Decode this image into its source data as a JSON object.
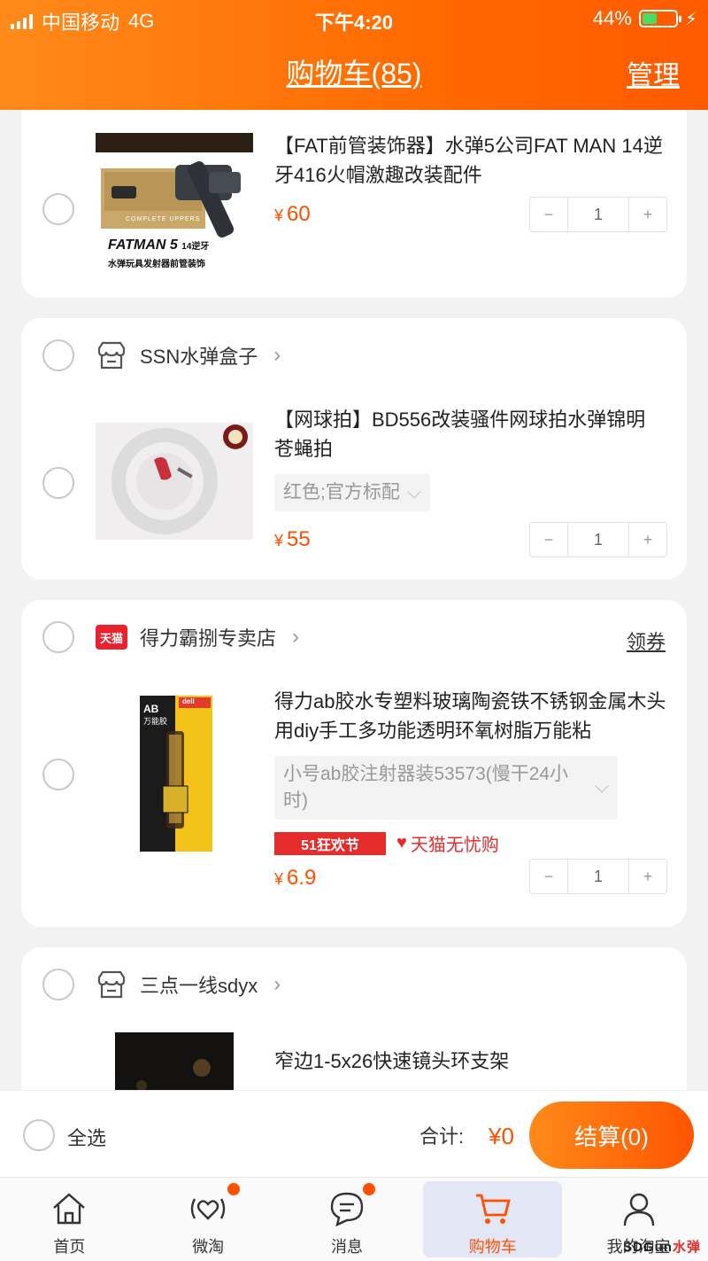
{
  "status_bar": {
    "carrier": "中国移动",
    "network": "4G",
    "time": "下午4:20",
    "battery": "44%",
    "battery_level": 0.44
  },
  "nav": {
    "title": "购物车(85)",
    "manage": "管理"
  },
  "items": [
    {
      "title": "【FAT前管装饰器】水弹5公司FAT MAN 14逆牙416火帽激趣改装配件",
      "price_symbol": "¥",
      "price": "60",
      "qty": "1",
      "thumb": {
        "name": "FATMAN 5",
        "sub1": "14逆牙",
        "sub2": "水弹玩具发射器前管装饰",
        "box": "COMPLETE UPPERS"
      }
    },
    {
      "shop": "SSN水弹盒子",
      "title": "【网球拍】BD556改装骚件网球拍水弹锦明苍蝇拍",
      "sku": "红色;官方标配",
      "price_symbol": "¥",
      "price": "55",
      "qty": "1"
    },
    {
      "shop": "得力霸捌专卖店",
      "shop_badge": "天猫",
      "coupon": "领券",
      "title": "得力ab胶水专塑料玻璃陶瓷铁不锈钢金属木头用diy手工多功能透明环氧树脂万能粘",
      "sku": "小号ab胶注射器装53573(慢干24小时)",
      "promo1": "51狂欢节",
      "promo2": "天猫无忧购",
      "price_symbol": "¥",
      "price": "6.9",
      "qty": "1",
      "thumb": {
        "brand": "deli",
        "label": "AB",
        "sub": "万能胶"
      }
    },
    {
      "shop": "三点一线sdyx",
      "title": "窄边1-5x26快速镜头环支架"
    }
  ],
  "stepper": {
    "minus": "−",
    "plus": "+"
  },
  "checkout": {
    "select_all": "全选",
    "total_label": "合计:",
    "total_value": "¥0",
    "settle": "结算(0)"
  },
  "tabs": [
    {
      "label": "首页",
      "icon": "home-icon"
    },
    {
      "label": "微淘",
      "icon": "heart-broadcast-icon"
    },
    {
      "label": "消息",
      "icon": "message-icon"
    },
    {
      "label": "购物车",
      "icon": "cart-icon"
    },
    {
      "label": "我的淘宝",
      "icon": "user-icon"
    }
  ],
  "watermark": {
    "a": "SDGun",
    "b": "水弹"
  },
  "colors": {
    "accent": "#ff5000",
    "header": "#ff7a10",
    "tmall": "#e8232f"
  }
}
